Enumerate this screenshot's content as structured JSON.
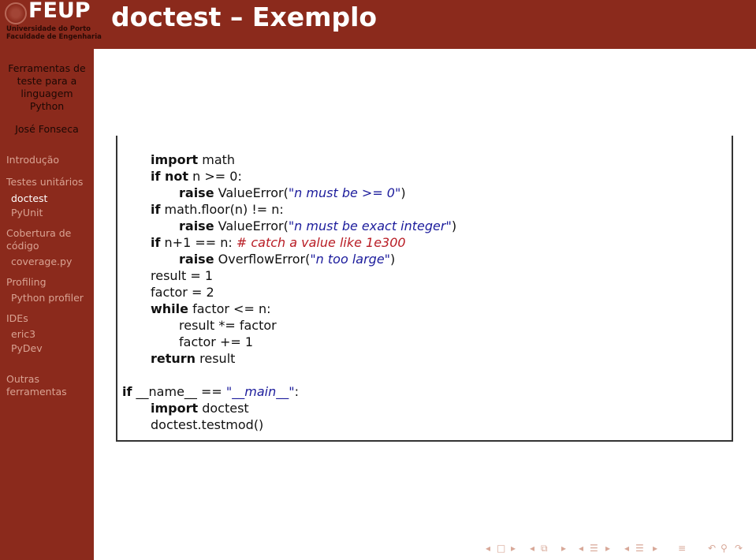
{
  "header": {
    "logo": {
      "name": "FEUP",
      "line1": "Universidade do Porto",
      "line2": "Faculdade de Engenharia"
    },
    "title": "doctest – Exemplo"
  },
  "sidebar": {
    "presentation_title": [
      "Ferramentas de",
      "teste para a",
      "linguagem",
      "Python"
    ],
    "author": "José Fonseca",
    "nav": [
      {
        "label": "Introdução",
        "level": "section",
        "active": false
      },
      {
        "label": "Testes unitários",
        "level": "section",
        "active": false
      },
      {
        "label": "doctest",
        "level": "subsection",
        "active": true
      },
      {
        "label": "PyUnit",
        "level": "subsection",
        "active": false
      },
      {
        "label": "Cobertura de",
        "level": "section",
        "active": false
      },
      {
        "label": "código",
        "level": "section-cont",
        "active": false
      },
      {
        "label": "coverage.py",
        "level": "subsection",
        "active": false
      },
      {
        "label": "Profiling",
        "level": "section",
        "active": false
      },
      {
        "label": "Python profiler",
        "level": "subsection",
        "active": false
      },
      {
        "label": "IDEs",
        "level": "section",
        "active": false
      },
      {
        "label": "eric3",
        "level": "subsection",
        "active": false
      },
      {
        "label": "PyDev",
        "level": "subsection",
        "active": false
      },
      {
        "label": "Outras",
        "level": "section",
        "active": false
      },
      {
        "label": "ferramentas",
        "level": "section-cont",
        "active": false
      }
    ]
  },
  "code": {
    "lines": [
      {
        "indent": 1,
        "parts": [
          {
            "t": "kw",
            "v": "import"
          },
          {
            "t": "n",
            "v": " math"
          }
        ]
      },
      {
        "indent": 1,
        "parts": [
          {
            "t": "kw",
            "v": "if not"
          },
          {
            "t": "n",
            "v": " n >= 0:"
          }
        ]
      },
      {
        "indent": 2,
        "parts": [
          {
            "t": "kw",
            "v": "raise"
          },
          {
            "t": "n",
            "v": " ValueError("
          },
          {
            "t": "str",
            "v": "\"n must be >= 0\""
          },
          {
            "t": "n",
            "v": ")"
          }
        ]
      },
      {
        "indent": 1,
        "parts": [
          {
            "t": "kw",
            "v": "if"
          },
          {
            "t": "n",
            "v": " math.floor(n) != n:"
          }
        ]
      },
      {
        "indent": 2,
        "parts": [
          {
            "t": "kw",
            "v": "raise"
          },
          {
            "t": "n",
            "v": " ValueError("
          },
          {
            "t": "str",
            "v": "\"n must be exact integer\""
          },
          {
            "t": "n",
            "v": ")"
          }
        ]
      },
      {
        "indent": 1,
        "parts": [
          {
            "t": "kw",
            "v": "if"
          },
          {
            "t": "n",
            "v": " n+1 == n: "
          },
          {
            "t": "cm",
            "v": "# catch a value like 1e300"
          }
        ]
      },
      {
        "indent": 2,
        "parts": [
          {
            "t": "kw",
            "v": "raise"
          },
          {
            "t": "n",
            "v": " OverflowError("
          },
          {
            "t": "str",
            "v": "\"n too large\""
          },
          {
            "t": "n",
            "v": ")"
          }
        ]
      },
      {
        "indent": 1,
        "parts": [
          {
            "t": "n",
            "v": "result = 1"
          }
        ]
      },
      {
        "indent": 1,
        "parts": [
          {
            "t": "n",
            "v": "factor = 2"
          }
        ]
      },
      {
        "indent": 1,
        "parts": [
          {
            "t": "kw",
            "v": "while"
          },
          {
            "t": "n",
            "v": " factor <= n:"
          }
        ]
      },
      {
        "indent": 2,
        "parts": [
          {
            "t": "n",
            "v": "result *= factor"
          }
        ]
      },
      {
        "indent": 2,
        "parts": [
          {
            "t": "n",
            "v": "factor += 1"
          }
        ]
      },
      {
        "indent": 1,
        "parts": [
          {
            "t": "kw",
            "v": "return"
          },
          {
            "t": "n",
            "v": " result"
          }
        ]
      },
      {
        "indent": 0,
        "parts": []
      },
      {
        "indent": 0,
        "parts": [
          {
            "t": "kw",
            "v": "if"
          },
          {
            "t": "n",
            "v": " __name__ == "
          },
          {
            "t": "str",
            "v": "\"__main__\""
          },
          {
            "t": "n",
            "v": ":"
          }
        ]
      },
      {
        "indent": 1,
        "parts": [
          {
            "t": "kw",
            "v": "import"
          },
          {
            "t": "n",
            "v": " doctest"
          }
        ]
      },
      {
        "indent": 1,
        "parts": [
          {
            "t": "n",
            "v": "doctest.testmod()"
          }
        ]
      }
    ]
  },
  "navbar": {
    "icons": [
      {
        "name": "prev-frame-icon",
        "glyph": "◂"
      },
      {
        "name": "frame-icon",
        "glyph": "□"
      },
      {
        "name": "next-frame-icon",
        "glyph": "▸"
      },
      {
        "name": "prev-slide-icon",
        "glyph": "◂"
      },
      {
        "name": "slide-icon",
        "glyph": "⧉"
      },
      {
        "name": "next-slide-icon",
        "glyph": "▸"
      },
      {
        "name": "prev-subsection-icon",
        "glyph": "◂"
      },
      {
        "name": "subsection-icon",
        "glyph": "☰"
      },
      {
        "name": "next-subsection-icon",
        "glyph": "▸"
      },
      {
        "name": "prev-section-icon",
        "glyph": "◂"
      },
      {
        "name": "section-icon",
        "glyph": "☰"
      },
      {
        "name": "next-section-icon",
        "glyph": "▸"
      },
      {
        "name": "toc-icon",
        "glyph": "≡"
      },
      {
        "name": "back-icon",
        "glyph": "↶"
      },
      {
        "name": "search-icon",
        "glyph": "⚲"
      },
      {
        "name": "forward-icon",
        "glyph": "↷"
      }
    ]
  },
  "colors": {
    "theme": "#8b2a1c",
    "nav_inactive": "#d9a393",
    "nav_active": "#ffffff",
    "string": "#1c1c9c",
    "comment": "#b81c24"
  }
}
